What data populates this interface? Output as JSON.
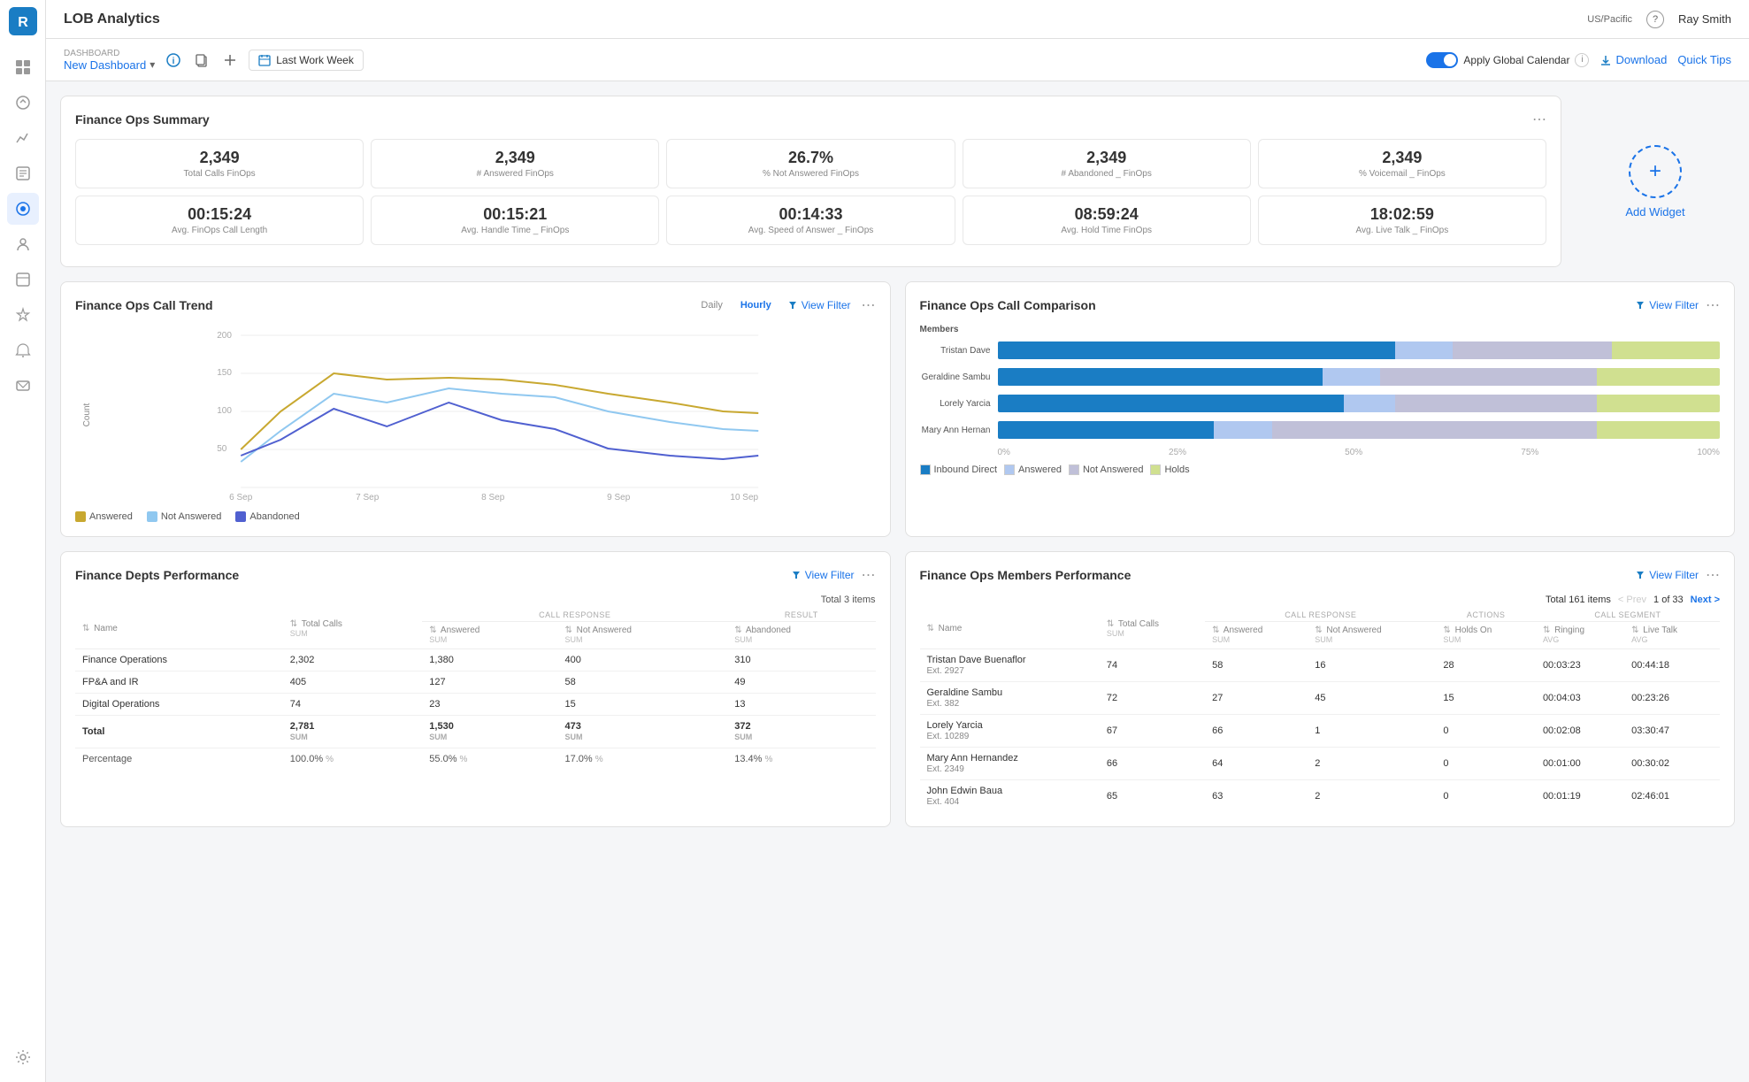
{
  "topbar": {
    "title": "LOB Analytics",
    "timezone": "US/Pacific",
    "user": "Ray Smith",
    "download_label": "Download",
    "quick_tips_label": "Quick Tips"
  },
  "toolbar": {
    "label": "DASHBOARD",
    "dashboard_name": "New Dashboard",
    "date_range": "Last Work Week",
    "apply_global_calendar": "Apply Global Calendar"
  },
  "summary": {
    "title": "Finance Ops Summary",
    "stats_row1": [
      {
        "value": "2,349",
        "label": "Total Calls FinOps"
      },
      {
        "value": "2,349",
        "label": "# Answered FinOps"
      },
      {
        "value": "26.7%",
        "label": "% Not Answered FinOps"
      },
      {
        "value": "2,349",
        "label": "# Abandoned _ FinOps"
      },
      {
        "value": "2,349",
        "label": "% Voicemail _ FinOps"
      }
    ],
    "stats_row2": [
      {
        "value": "00:15:24",
        "label": "Avg. FinOps Call Length"
      },
      {
        "value": "00:15:21",
        "label": "Avg. Handle Time _ FinOps"
      },
      {
        "value": "00:14:33",
        "label": "Avg. Speed of Answer _ FinOps"
      },
      {
        "value": "08:59:24",
        "label": "Avg. Hold Time FinOps"
      },
      {
        "value": "18:02:59",
        "label": "Avg. Live Talk _ FinOps"
      }
    ],
    "add_widget_label": "Add Widget"
  },
  "call_trend": {
    "title": "Finance Ops Call Trend",
    "view_filter": "View Filter",
    "toggle_daily": "Daily",
    "toggle_hourly": "Hourly",
    "y_label": "Count",
    "x_labels": [
      "6 Sep",
      "7 Sep",
      "8 Sep",
      "9 Sep",
      "10 Sep"
    ],
    "y_ticks": [
      "200",
      "150",
      "100",
      "50"
    ],
    "legend": [
      {
        "label": "Answered",
        "color": "#c8a830"
      },
      {
        "label": "Not Answered",
        "color": "#90c8f0"
      },
      {
        "label": "Abandoned",
        "color": "#5060d0"
      }
    ]
  },
  "call_comparison": {
    "title": "Finance Ops Call Comparison",
    "view_filter": "View Filter",
    "members": [
      "Tristan Dave",
      "Geraldine Sambu",
      "Lorely Yarcia",
      "Mary Ann Hernan"
    ],
    "legend": [
      {
        "label": "Inbound Direct",
        "color": "#1a7dc4"
      },
      {
        "label": "Answered",
        "color": "#b0c8f0"
      },
      {
        "label": "Not Answered",
        "color": "#c0c0d8"
      },
      {
        "label": "Holds",
        "color": "#d0e090"
      }
    ],
    "bars": [
      {
        "inbound": 55,
        "answered": 8,
        "not_answered": 22,
        "holds": 15
      },
      {
        "inbound": 45,
        "answered": 8,
        "not_answered": 30,
        "holds": 17
      },
      {
        "inbound": 48,
        "answered": 7,
        "not_answered": 28,
        "holds": 17
      },
      {
        "inbound": 30,
        "answered": 8,
        "not_answered": 45,
        "holds": 17
      }
    ],
    "x_axis": [
      "0%",
      "25%",
      "50%",
      "75%",
      "100%"
    ]
  },
  "depts_performance": {
    "title": "Finance Depts Performance",
    "view_filter": "View Filter",
    "total_items": "Total 3 items",
    "columns": {
      "name": "Name",
      "total_calls": "Total Calls",
      "answered": "Answered",
      "not_answered": "Not Answered",
      "abandoned": "Abandoned"
    },
    "sub_headers": {
      "call_response": "CALL RESPONSE",
      "result": "RESULT"
    },
    "rows": [
      {
        "name": "Finance Operations",
        "total_calls": "2,302",
        "answered": "1,380",
        "not_answered": "400",
        "abandoned": "310"
      },
      {
        "name": "FP&A and IR",
        "total_calls": "405",
        "answered": "127",
        "not_answered": "58",
        "abandoned": "49"
      },
      {
        "name": "Digital Operations",
        "total_calls": "74",
        "answered": "23",
        "not_answered": "15",
        "abandoned": "13"
      }
    ],
    "total_row": {
      "name": "Total",
      "total_calls": "2,781",
      "answered": "1,530",
      "not_answered": "473",
      "abandoned": "372",
      "label_sum": "SUM"
    },
    "pct_row": {
      "name": "Percentage",
      "total_calls": "100.0%",
      "answered": "55.0%",
      "not_answered": "17.0%",
      "abandoned": "13.4%"
    }
  },
  "members_performance": {
    "title": "Finance Ops Members Performance",
    "view_filter": "View Filter",
    "total_items": "Total 161 items",
    "pagination": {
      "prev": "< Prev",
      "current": "1 of 33",
      "next": "Next >"
    },
    "columns": {
      "name": "Name",
      "total_calls": "Total Calls",
      "answered": "Answered",
      "not_answered": "Not Answered",
      "holds_on": "Holds On",
      "ringing": "Ringing",
      "live_talk": "Live Talk"
    },
    "sub_headers": {
      "call_response": "CALL RESPONSE",
      "actions": "ACTIONS",
      "call_segment": "CALL SEGMENT"
    },
    "rows": [
      {
        "name": "Tristan Dave Buenaflor",
        "ext": "Ext. 2927",
        "total_calls": "74",
        "answered": "58",
        "not_answered": "16",
        "holds_on": "28",
        "ringing": "00:03:23",
        "live_talk": "00:44:18"
      },
      {
        "name": "Geraldine Sambu",
        "ext": "Ext. 382",
        "total_calls": "72",
        "answered": "27",
        "not_answered": "45",
        "holds_on": "15",
        "ringing": "00:04:03",
        "live_talk": "00:23:26"
      },
      {
        "name": "Lorely Yarcia",
        "ext": "Ext. 10289",
        "total_calls": "67",
        "answered": "66",
        "not_answered": "1",
        "holds_on": "0",
        "ringing": "00:02:08",
        "live_talk": "03:30:47"
      },
      {
        "name": "Mary Ann Hernandez",
        "ext": "Ext. 2349",
        "total_calls": "66",
        "answered": "64",
        "not_answered": "2",
        "holds_on": "0",
        "ringing": "00:01:00",
        "live_talk": "00:30:02"
      },
      {
        "name": "John Edwin Baua",
        "ext": "Ext. 404",
        "total_calls": "65",
        "answered": "63",
        "not_answered": "2",
        "holds_on": "0",
        "ringing": "00:01:19",
        "live_talk": "02:46:01"
      }
    ]
  }
}
